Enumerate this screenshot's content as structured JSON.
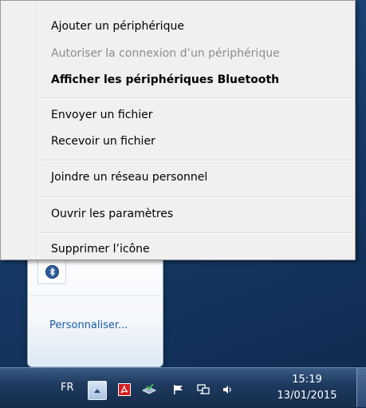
{
  "context_menu": {
    "items": [
      {
        "label": "Ajouter un périphérique",
        "enabled": true,
        "bold": false
      },
      {
        "label": "Autoriser la connexion d’un périphérique",
        "enabled": false,
        "bold": false
      },
      {
        "label": "Afficher les périphériques Bluetooth",
        "enabled": true,
        "bold": true
      },
      {
        "label": "Envoyer un fichier",
        "enabled": true,
        "bold": false
      },
      {
        "label": "Recevoir un fichier",
        "enabled": true,
        "bold": false
      },
      {
        "label": "Joindre un réseau personnel",
        "enabled": true,
        "bold": false
      },
      {
        "label": "Ouvrir les paramètres",
        "enabled": true,
        "bold": false
      },
      {
        "label": "Supprimer l’icône",
        "enabled": true,
        "bold": false
      }
    ]
  },
  "tray_flyout": {
    "customize_label": "Personnaliser...",
    "icons": [
      "bluetooth-icon"
    ]
  },
  "taskbar": {
    "language": "FR",
    "tray_icons": [
      "show-hidden-icons-icon",
      "adobe-icon",
      "network-drive-icon",
      "action-center-flag-icon",
      "network-icon",
      "volume-icon"
    ],
    "clock": {
      "time": "15:19",
      "date": "13/01/2015"
    }
  },
  "colors": {
    "menu_background": "#f0f0f0",
    "disabled_text": "#8d8d8d",
    "link": "#1a5aa8",
    "taskbar": "#1e3a5f",
    "adobe_red": "#d4201f",
    "bluetooth_blue": "#2f5b9a"
  }
}
